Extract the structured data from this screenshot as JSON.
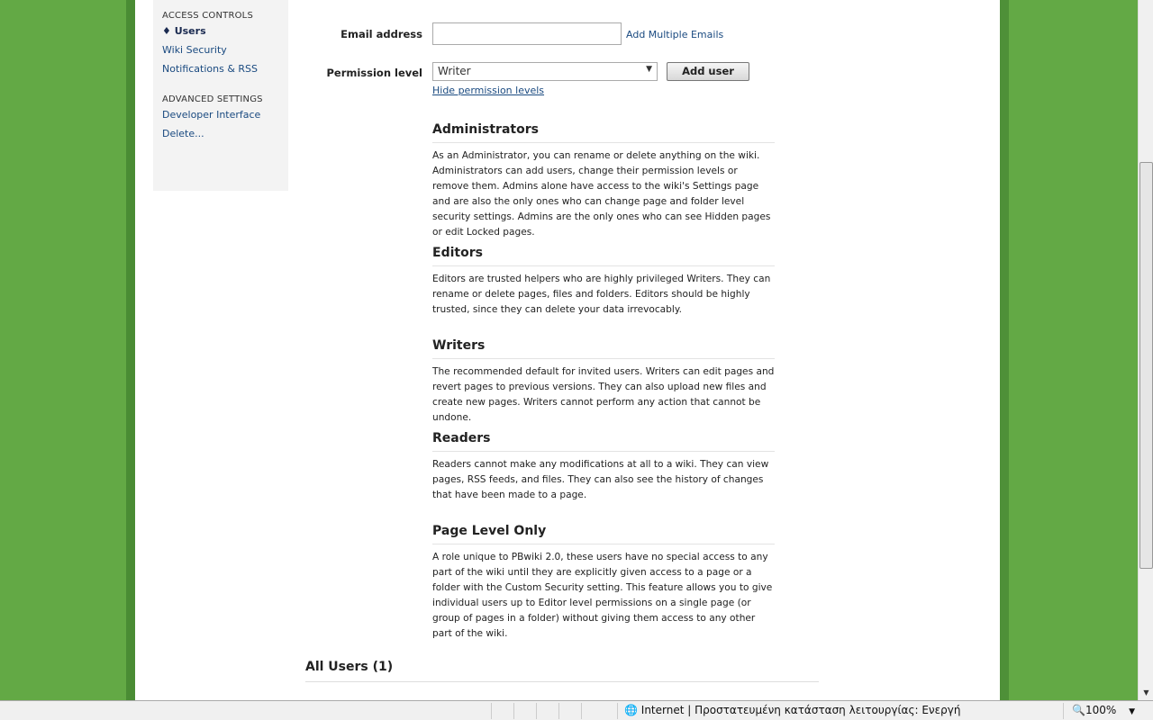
{
  "sidebar": {
    "access_heading": "ACCESS CONTROLS",
    "items": [
      {
        "label": "Users"
      },
      {
        "label": "Wiki Security"
      },
      {
        "label": "Notifications & RSS"
      }
    ],
    "advanced_heading": "ADVANCED SETTINGS",
    "advanced_items": [
      {
        "label": "Developer Interface"
      },
      {
        "label": "Delete..."
      }
    ]
  },
  "form": {
    "email_label": "Email address",
    "email_value": "",
    "add_multiple": "Add Multiple Emails",
    "permission_label": "Permission level",
    "permission_value": "Writer",
    "add_user": "Add user",
    "hide_levels": "Hide permission levels"
  },
  "sections": [
    {
      "title": "Administrators",
      "text": "As an Administrator, you can rename or delete anything on the wiki. Administrators can add users, change their permission levels or remove them. Admins alone have access to the wiki's Settings page and are also the only ones who can change page and folder level security settings. Admins are the only ones who can see Hidden pages or edit Locked pages."
    },
    {
      "title": "Editors",
      "text": "Editors are trusted helpers who are highly privileged Writers. They can rename or delete pages, files and folders. Editors should be highly trusted, since they can delete your data irrevocably."
    },
    {
      "title": "Writers",
      "text": "The recommended default for invited users. Writers can edit pages and revert pages to previous versions. They can also upload new files and create new pages. Writers cannot perform any action that cannot be undone."
    },
    {
      "title": "Readers",
      "text": "Readers cannot make any modifications at all to a wiki. They can view pages, RSS feeds, and files. They can also see the history of changes that have been made to a page."
    },
    {
      "title": "Page Level Only",
      "text": "A role unique to PBwiki 2.0, these users have no special access to any part of the wiki until they are explicitly given access to a page or a folder with the Custom Security setting. This feature allows you to give individual users up to Editor level permissions on a single page (or group of pages in a folder) without giving them access to any other part of the wiki."
    }
  ],
  "all_users": "All Users (1)",
  "status": {
    "zone": "Internet | Προστατευμένη κατάσταση λειτουργίας: Ενεργή",
    "zoom": "100%"
  }
}
